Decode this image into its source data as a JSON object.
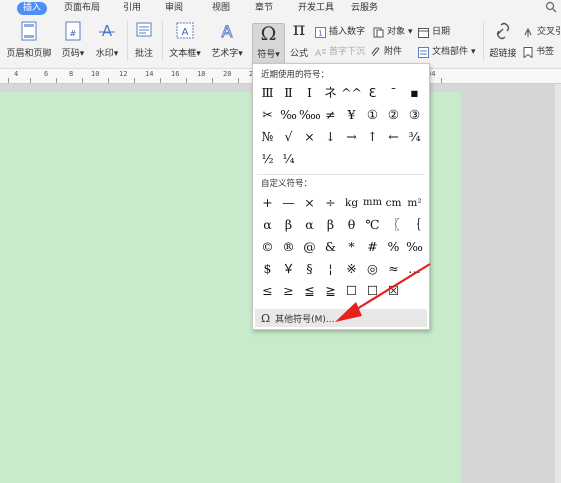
{
  "tabs": [
    "插入",
    "页面布局",
    "引用",
    "审阅",
    "视图",
    "章节",
    "开发工具",
    "云服务"
  ],
  "ribbon": {
    "header_footer": "页眉和页脚",
    "page_number": "页码",
    "watermark": "水印",
    "comment": "批注",
    "textbox": "文本框",
    "wordart": "艺术字",
    "symbol": "符号",
    "formula": "公式",
    "insert_number": "插入数字",
    "object": "对象",
    "date": "日期",
    "drop_cap": "首字下沉",
    "attachment": "附件",
    "doc_parts": "文档部件",
    "hyperlink": "超链接",
    "bookmark": "书签",
    "cross_ref": "交叉引"
  },
  "ruler": [
    "4",
    "6",
    "8",
    "10",
    "12",
    "14",
    "16",
    "18",
    "20",
    "22",
    "34"
  ],
  "symbol_menu": {
    "recent_title": "近期使用的符号：",
    "recent": [
      "Ⅲ",
      "Ⅱ",
      "Ⅰ",
      "ネ",
      "^^",
      "ℇ",
      "¯",
      "▪",
      "✂",
      "‰",
      "‱",
      "≠",
      "¥",
      "①",
      "②",
      "③",
      "№",
      "√",
      "×",
      "↓",
      "→",
      "↑",
      "←",
      "¾",
      "½",
      "¼"
    ],
    "custom_title": "自定义符号：",
    "custom": [
      "+",
      "—",
      "×",
      "÷",
      "kg",
      "mm",
      "cm",
      "m²",
      "α",
      "β",
      "α",
      "β",
      "θ",
      "℃",
      "〖",
      "｛",
      "©",
      "®",
      "@",
      "&",
      "*",
      "#",
      "%",
      "‰",
      "$",
      "￥",
      "§",
      "¦",
      "※",
      "◎",
      "≈",
      "…",
      "≤",
      "≥",
      "≦",
      "≧",
      "☐",
      "☐",
      "☒",
      ""
    ],
    "more": "其他符号(M)..."
  }
}
